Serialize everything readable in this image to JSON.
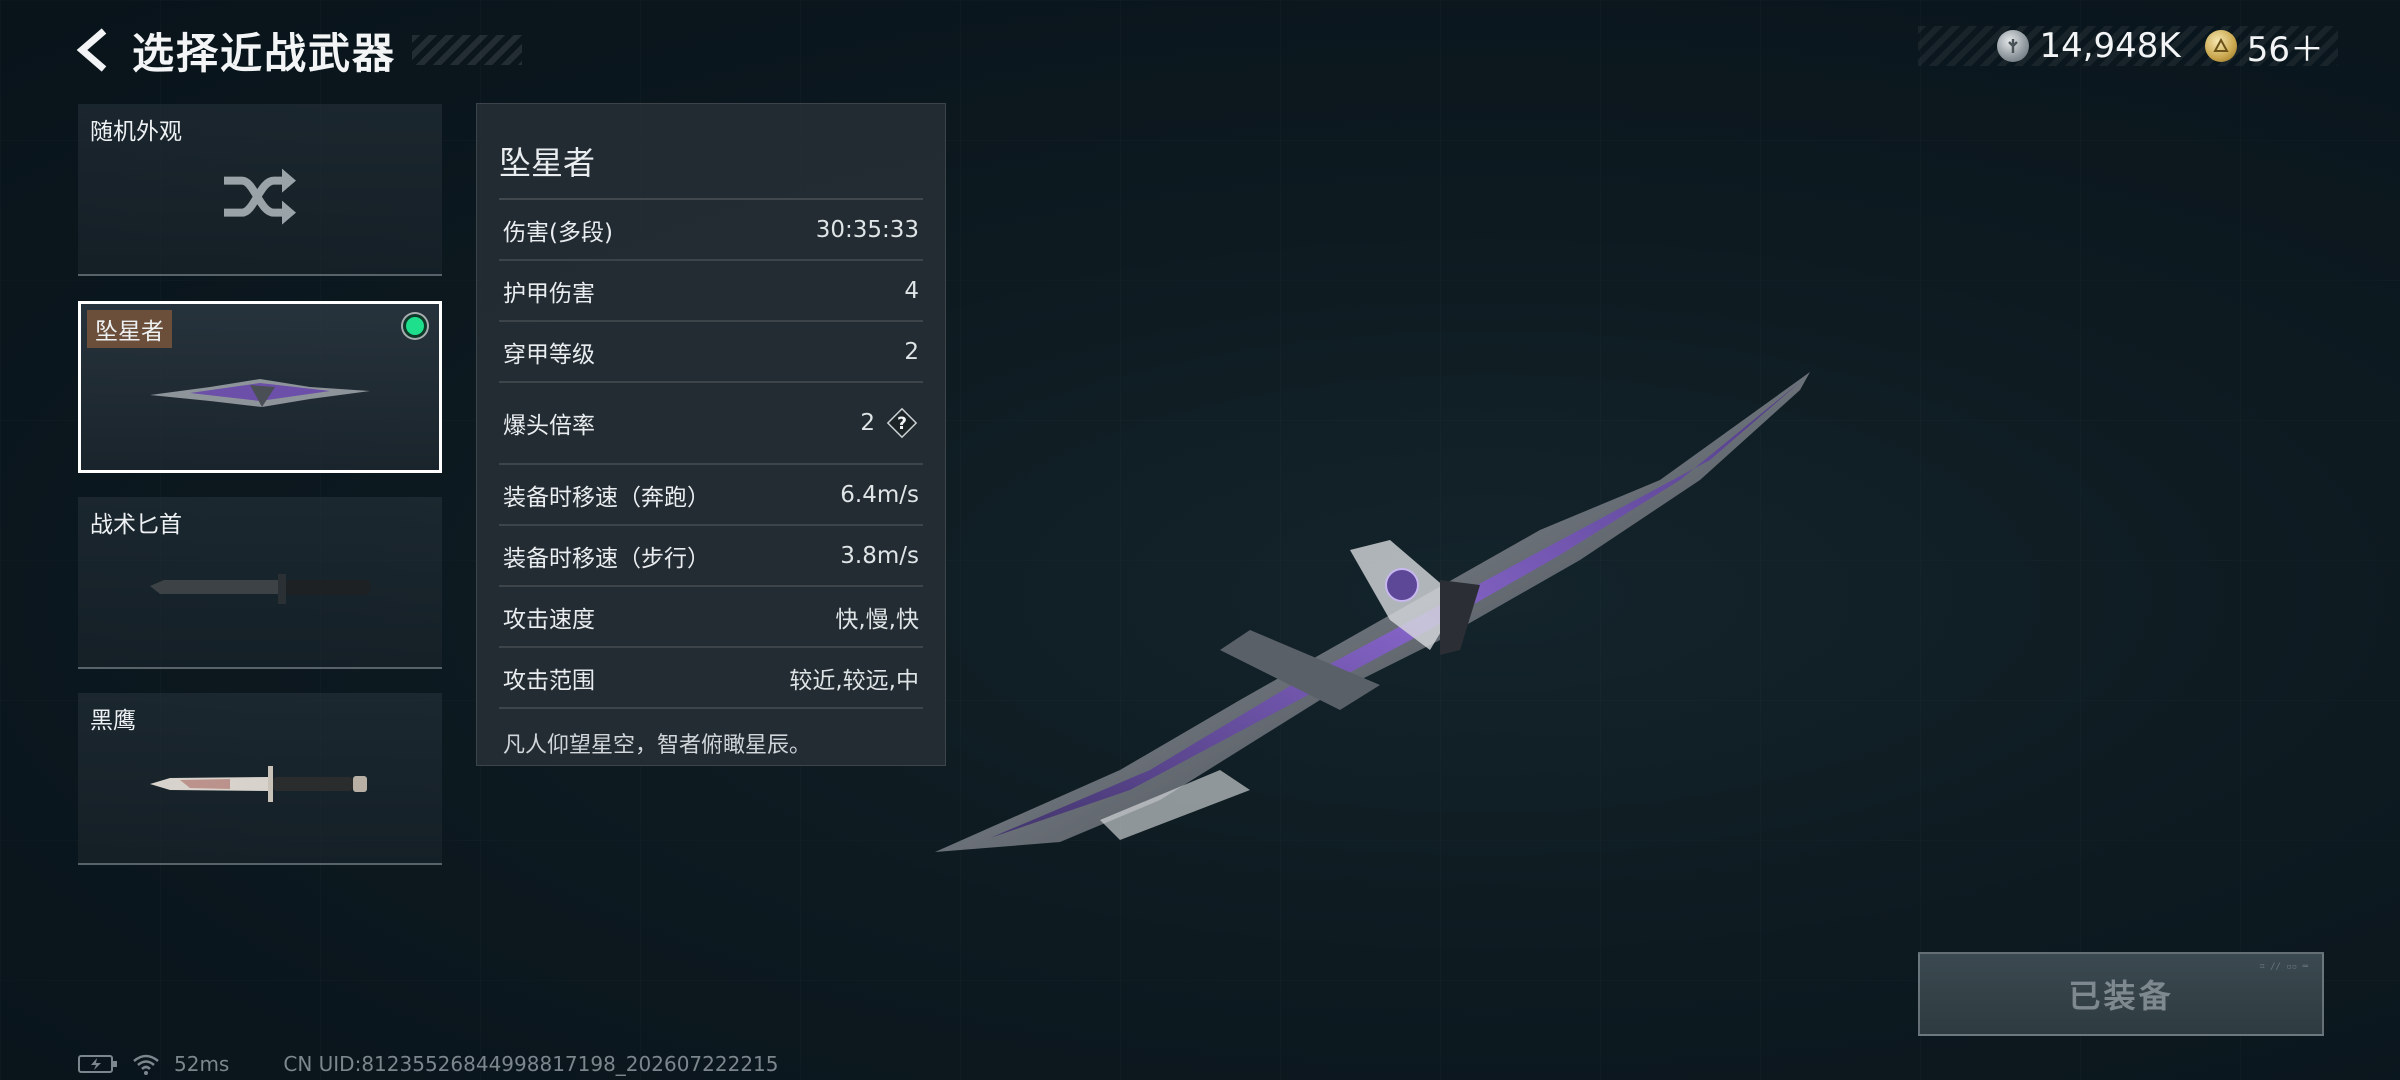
{
  "header": {
    "title": "选择近战武器"
  },
  "currency": [
    {
      "icon": "silver-coin-icon",
      "value": "14,948K"
    },
    {
      "icon": "gold-coin-icon",
      "value": "56＋"
    }
  ],
  "weapons": [
    {
      "label": "随机外观",
      "icon": "shuffle-icon",
      "selected": false
    },
    {
      "label": "坠星者",
      "icon": "starfall-knife-icon",
      "selected": true,
      "equipped": true
    },
    {
      "label": "战术匕首",
      "icon": "tactical-dagger-icon",
      "selected": false
    },
    {
      "label": "黑鹰",
      "icon": "black-hawk-knife-icon",
      "selected": false
    }
  ],
  "details": {
    "name": "坠星者",
    "stats": [
      {
        "label": "伤害(多段)",
        "value": "30:35:33"
      },
      {
        "label": "护甲伤害",
        "value": "4"
      },
      {
        "label": "穿甲等级",
        "value": "2"
      },
      {
        "label": "爆头倍率",
        "value": "2"
      },
      {
        "label": "装备时移速（奔跑）",
        "value": "6.4m/s"
      },
      {
        "label": "装备时移速（步行）",
        "value": "3.8m/s"
      },
      {
        "label": "攻击速度",
        "value": "快,慢,快"
      },
      {
        "label": "攻击范围",
        "value": "较近,较远,中"
      }
    ],
    "description": "凡人仰望星空，智者俯瞰星辰。"
  },
  "equip_button": {
    "label": "已装备"
  },
  "status": {
    "ping": "52ms",
    "uid": "CN UID:8123552684499881719​8_202607222215"
  },
  "colors": {
    "equipped": "#1ee08c",
    "accent_purple": "#7a4fc8"
  }
}
